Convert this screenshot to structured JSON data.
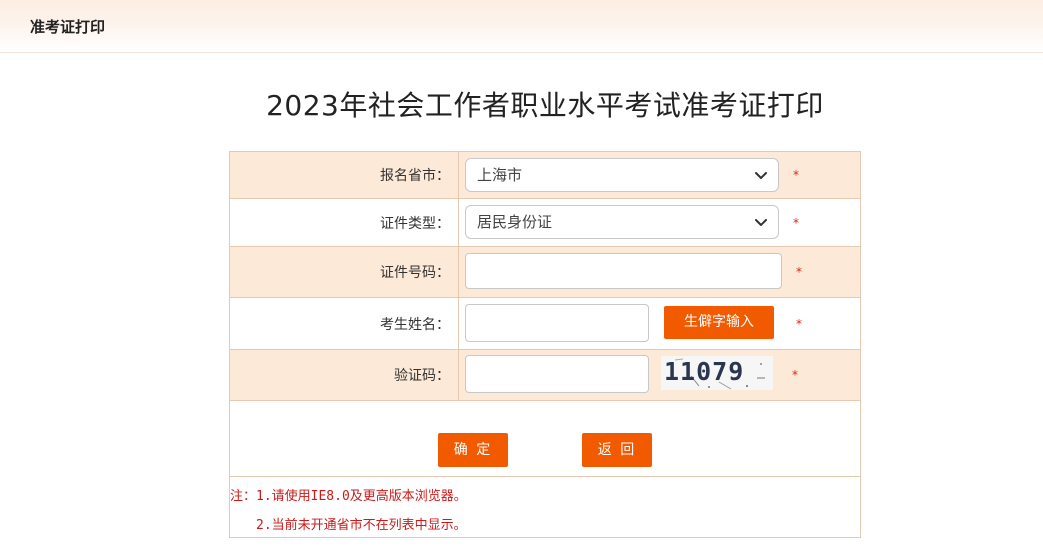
{
  "header": {
    "breadcrumb": "准考证打印"
  },
  "page_title": "2023年社会工作者职业水平考试准考证打印",
  "form": {
    "province": {
      "label": "报名省市：",
      "selected": "上海市",
      "required_mark": "*"
    },
    "id_type": {
      "label": "证件类型：",
      "selected": "居民身份证",
      "required_mark": "*"
    },
    "id_number": {
      "label": "证件号码：",
      "value": "",
      "required_mark": "*"
    },
    "name": {
      "label": "考生姓名：",
      "value": "",
      "rare_char_button": "生僻字输入",
      "required_mark": "*"
    },
    "captcha": {
      "label": "验证码：",
      "value": "",
      "image_text": "11079",
      "required_mark": "*"
    }
  },
  "actions": {
    "confirm_label": "确 定",
    "back_label": "返 回"
  },
  "notes": {
    "line1": "注：1.请使用IE8.0及更高版本浏览器。",
    "line2": "2.当前未开通省市不在列表中显示。"
  },
  "colors": {
    "accent": "#f25a00",
    "row_shade": "#fde9d7",
    "border": "#e5c9b0",
    "note_red": "#cc1a1a"
  }
}
